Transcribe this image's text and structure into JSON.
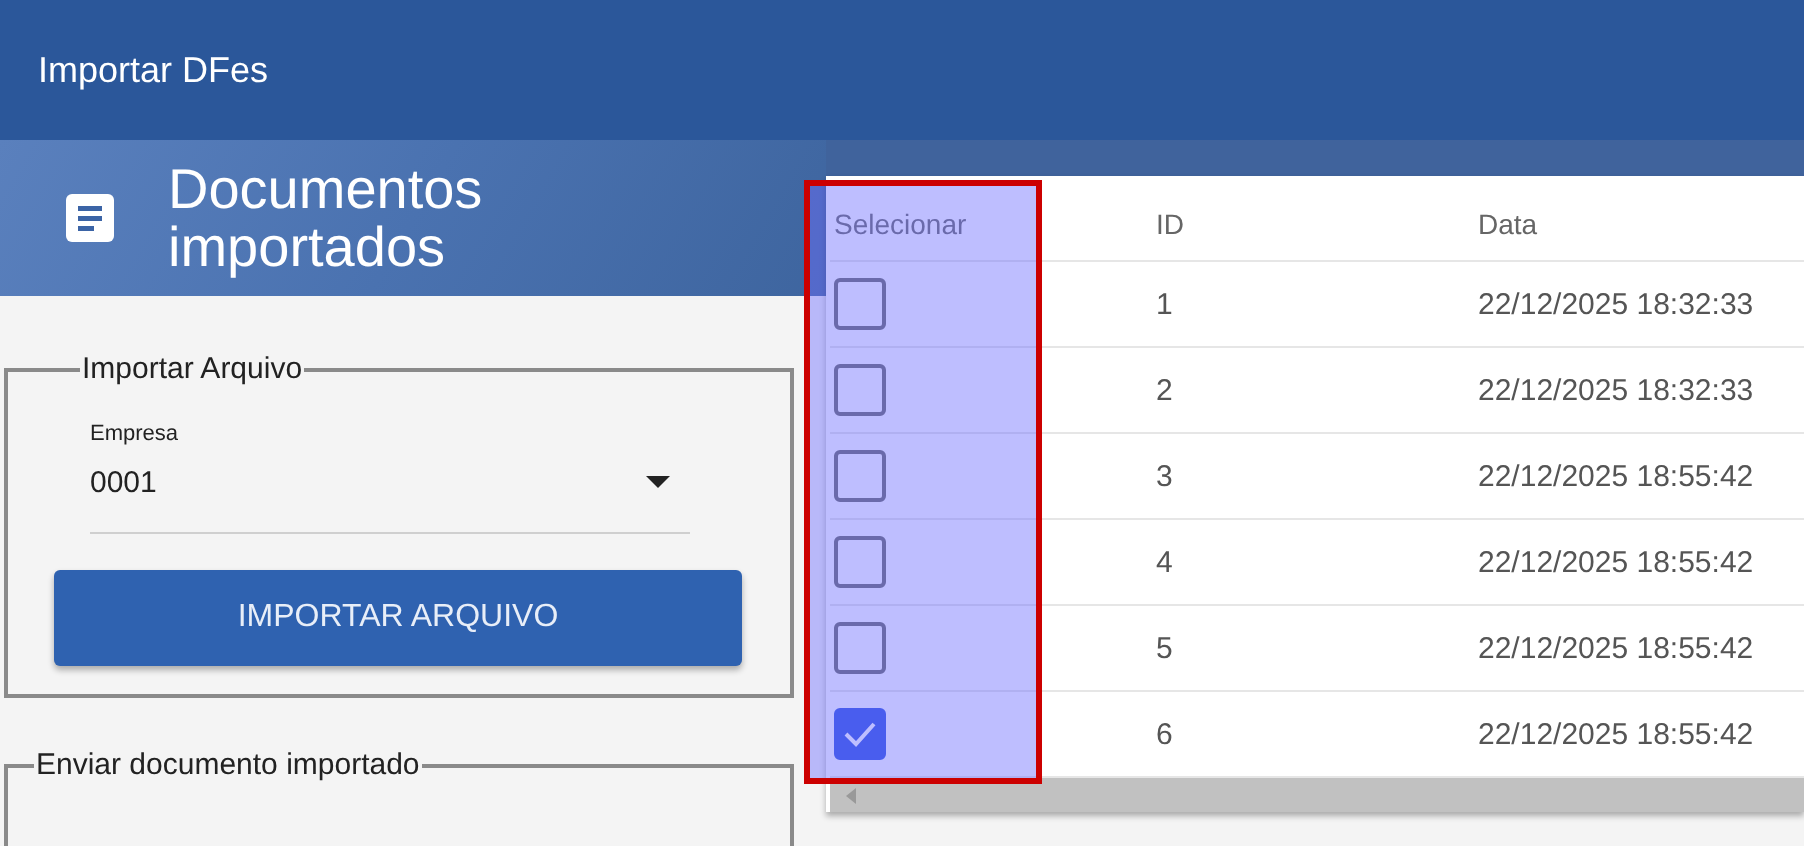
{
  "app_bar": {
    "title": "Importar DFes"
  },
  "page_header": {
    "title": "Documentos importados"
  },
  "import_section": {
    "legend": "Importar Arquivo",
    "company_field": {
      "label": "Empresa",
      "value": "0001"
    },
    "button": "IMPORTAR ARQUIVO"
  },
  "send_section": {
    "legend": "Enviar documento importado"
  },
  "table": {
    "columns": [
      "Selecionar",
      "ID",
      "Data"
    ],
    "rows": [
      {
        "checked": false,
        "id": "1",
        "data": "22/12/2025 18:32:33"
      },
      {
        "checked": false,
        "id": "2",
        "data": "22/12/2025 18:32:33"
      },
      {
        "checked": false,
        "id": "3",
        "data": "22/12/2025 18:55:42"
      },
      {
        "checked": false,
        "id": "4",
        "data": "22/12/2025 18:55:42"
      },
      {
        "checked": false,
        "id": "5",
        "data": "22/12/2025 18:55:42"
      },
      {
        "checked": true,
        "id": "6",
        "data": "22/12/2025 18:55:42"
      }
    ]
  }
}
